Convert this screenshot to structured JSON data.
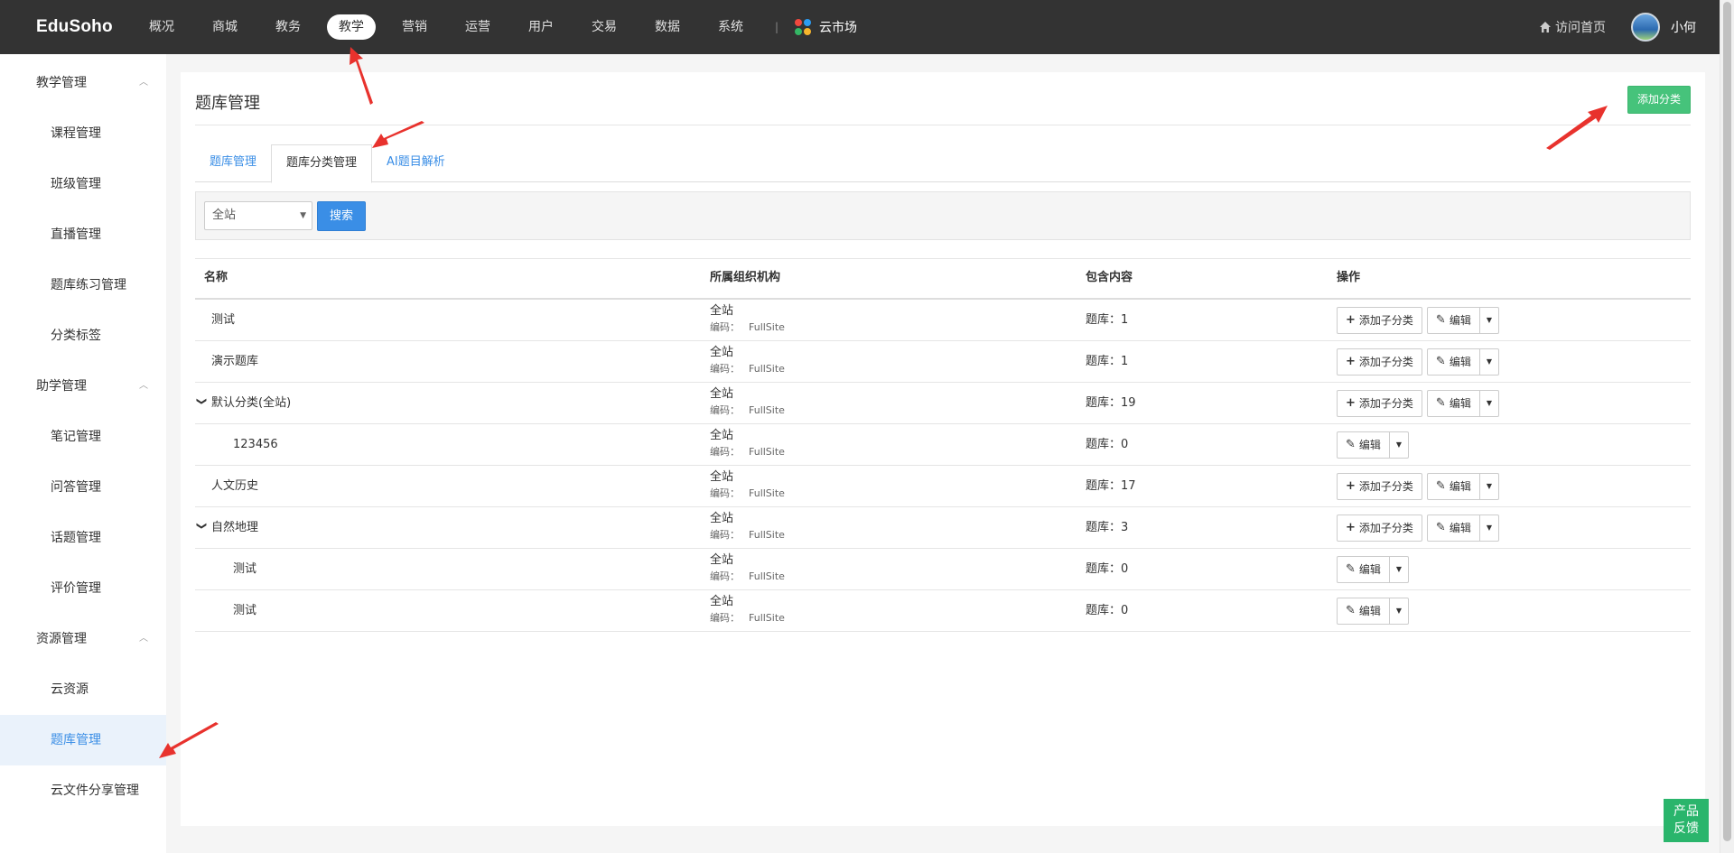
{
  "topbar": {
    "logo": "EduSoho",
    "nav": [
      "概况",
      "商城",
      "教务",
      "教学",
      "营销",
      "运营",
      "用户",
      "交易",
      "数据",
      "系统"
    ],
    "nav_active_index": 3,
    "separator": "|",
    "market": "云市场",
    "visit_home": "访问首页",
    "username": "小何"
  },
  "sidebar": {
    "groups": [
      {
        "label": "教学管理",
        "items": [
          "课程管理",
          "班级管理",
          "直播管理",
          "题库练习管理",
          "分类标签"
        ]
      },
      {
        "label": "助学管理",
        "items": [
          "笔记管理",
          "问答管理",
          "话题管理",
          "评价管理"
        ]
      },
      {
        "label": "资源管理",
        "items": [
          "云资源",
          "题库管理",
          "云文件分享管理"
        ]
      }
    ],
    "active_item": "题库管理"
  },
  "main": {
    "title": "题库管理",
    "add_button": "添加分类",
    "tabs": [
      "题库管理",
      "题库分类管理",
      "AI题目解析"
    ],
    "active_tab": 1,
    "filter": {
      "select_value": "全站",
      "search_button": "搜索"
    },
    "table": {
      "headers": [
        "名称",
        "所属组织机构",
        "包含内容",
        "操作"
      ],
      "code_label": "编码：",
      "rows": [
        {
          "name": "测试",
          "level": 0,
          "expanded": false,
          "org": "全站",
          "code": "FullSite",
          "count": "题库：1",
          "has_add_child": true
        },
        {
          "name": "演示题库",
          "level": 0,
          "expanded": false,
          "org": "全站",
          "code": "FullSite",
          "count": "题库：1",
          "has_add_child": true
        },
        {
          "name": "默认分类(全站)",
          "level": 0,
          "expanded": true,
          "org": "全站",
          "code": "FullSite",
          "count": "题库：19",
          "has_add_child": true
        },
        {
          "name": "123456",
          "level": 1,
          "expanded": false,
          "org": "全站",
          "code": "FullSite",
          "count": "题库：0",
          "has_add_child": false
        },
        {
          "name": "人文历史",
          "level": 0,
          "expanded": false,
          "org": "全站",
          "code": "FullSite",
          "count": "题库：17",
          "has_add_child": true
        },
        {
          "name": "自然地理",
          "level": 0,
          "expanded": true,
          "org": "全站",
          "code": "FullSite",
          "count": "题库：3",
          "has_add_child": true
        },
        {
          "name": "测试",
          "level": 1,
          "expanded": false,
          "org": "全站",
          "code": "FullSite",
          "count": "题库：0",
          "has_add_child": false
        },
        {
          "name": "测试",
          "level": 1,
          "expanded": false,
          "org": "全站",
          "code": "FullSite",
          "count": "题库：0",
          "has_add_child": false
        }
      ],
      "add_child_label": "添加子分类",
      "edit_label": "编辑"
    }
  },
  "feedback": {
    "line1": "产品",
    "line2": "反馈"
  },
  "colors": {
    "topbar": "#333333",
    "accent_blue": "#3a8ee6",
    "add_green": "#46c37b",
    "annotation_red": "#e8322d"
  }
}
